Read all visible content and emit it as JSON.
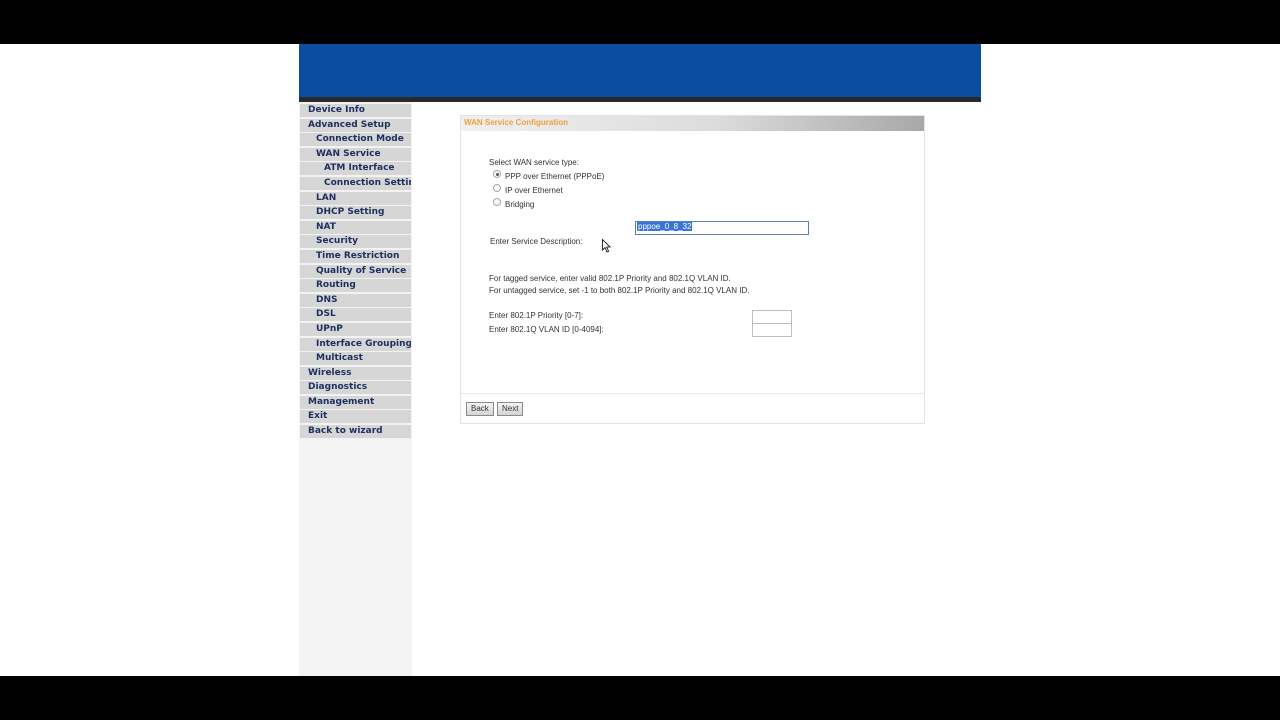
{
  "menu": [
    {
      "label": "Device Info",
      "level": 1
    },
    {
      "label": "Advanced Setup",
      "level": 1
    },
    {
      "label": "Connection Mode",
      "level": 2
    },
    {
      "label": "WAN Service",
      "level": 2
    },
    {
      "label": "ATM Interface",
      "level": 3
    },
    {
      "label": "Connection Setting",
      "level": 3
    },
    {
      "label": "LAN",
      "level": 2
    },
    {
      "label": "DHCP Setting",
      "level": 2
    },
    {
      "label": "NAT",
      "level": 2
    },
    {
      "label": "Security",
      "level": 2
    },
    {
      "label": "Time Restriction",
      "level": 2
    },
    {
      "label": "Quality of Service",
      "level": 2
    },
    {
      "label": "Routing",
      "level": 2
    },
    {
      "label": "DNS",
      "level": 2
    },
    {
      "label": "DSL",
      "level": 2
    },
    {
      "label": "UPnP",
      "level": 2
    },
    {
      "label": "Interface Grouping",
      "level": 2
    },
    {
      "label": "Multicast",
      "level": 2
    },
    {
      "label": "Wireless",
      "level": 1
    },
    {
      "label": "Diagnostics",
      "level": 1
    },
    {
      "label": "Management",
      "level": 1
    },
    {
      "label": "Exit",
      "level": 1
    },
    {
      "label": "Back to wizard",
      "level": 1
    }
  ],
  "panel": {
    "title": "WAN Service Configuration",
    "service_type_label": "Select WAN service type:",
    "options": [
      "PPP over Ethernet (PPPoE)",
      "IP over Ethernet",
      "Bridging"
    ],
    "selected_option": "PPP over Ethernet (PPPoE)",
    "service_desc_label": "Enter Service Description:",
    "service_desc_value": "pppoe_0_8_32",
    "note_tagged": "For tagged service, enter valid 802.1P Priority and 802.1Q VLAN ID.",
    "note_untagged": "For untagged service, set -1 to both 802.1P Priority and 802.1Q VLAN ID.",
    "priority_label": "Enter 802.1P Priority [0-7]:",
    "vlan_label": "Enter 802.1Q VLAN ID [0-4094]:",
    "priority_value": "",
    "vlan_value": "",
    "back_label": "Back",
    "next_label": "Next"
  },
  "colors": {
    "banner": "#0a4ea0",
    "menu_text": "#1c2f5e",
    "menu_bg": "#d6d6d6",
    "panel_title": "#f0a040",
    "selection": "#3875d7"
  },
  "icons": {
    "cursor": "mouse-pointer-icon"
  }
}
